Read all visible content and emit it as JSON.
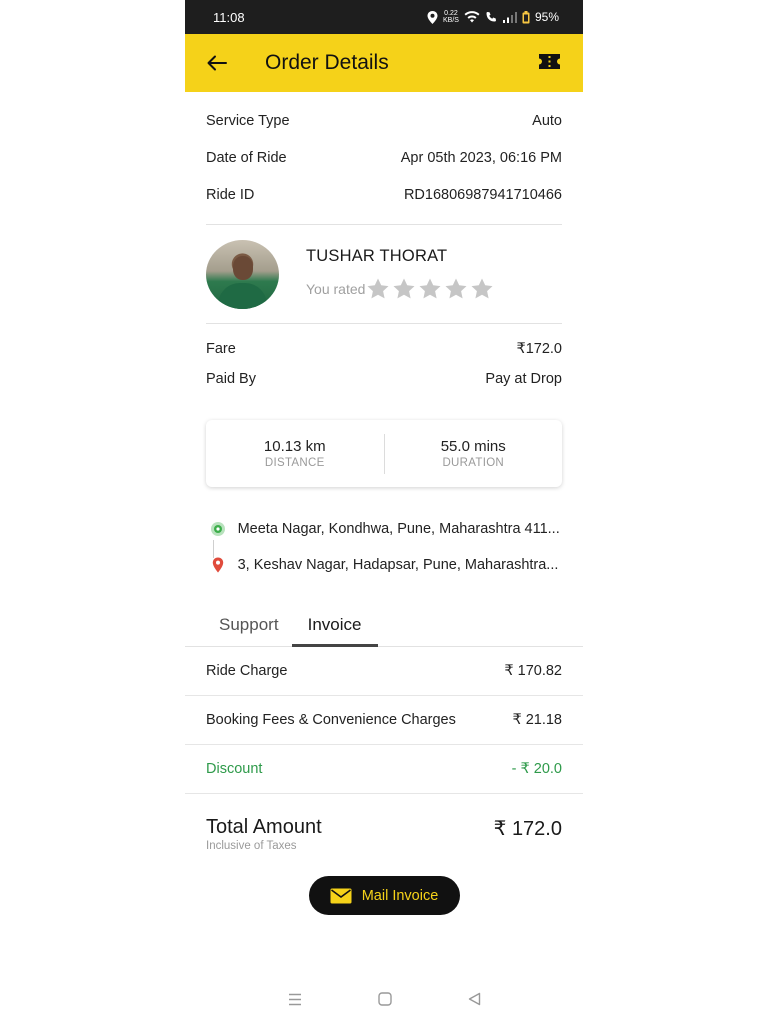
{
  "status_bar": {
    "time": "11:08",
    "data_speed": "0.22",
    "data_unit": "KB/S",
    "battery": "95%"
  },
  "app_bar": {
    "title": "Order Details",
    "back_icon": "arrow-left-icon",
    "action_icon": "ticket-icon"
  },
  "ride_info": [
    {
      "label": "Service Type",
      "value": "Auto"
    },
    {
      "label": "Date of Ride",
      "value": "Apr 05th 2023, 06:16 PM"
    },
    {
      "label": "Ride ID",
      "value": "RD16806987941710466"
    }
  ],
  "driver": {
    "name": "TUSHAR  THORAT",
    "rating_label": "You rated",
    "rating_value": 0,
    "rating_max": 5
  },
  "payment": [
    {
      "label": "Fare",
      "value": "₹172.0"
    },
    {
      "label": "Paid By",
      "value": "Pay at Drop"
    }
  ],
  "stats": {
    "distance_value": "10.13 km",
    "distance_label": "DISTANCE",
    "duration_value": "55.0 mins",
    "duration_label": "DURATION"
  },
  "route": {
    "pickup": "Meeta Nagar, Kondhwa, Pune, Maharashtra 411...",
    "drop": "3, Keshav Nagar, Hadapsar, Pune, Maharashtra..."
  },
  "tabs": [
    {
      "label": "Support",
      "active": false
    },
    {
      "label": "Invoice",
      "active": true
    }
  ],
  "invoice": [
    {
      "label": "Ride Charge",
      "value": "₹  170.82"
    },
    {
      "label": "Booking Fees & Convenience Charges",
      "value": "₹  21.18"
    },
    {
      "label": "Discount",
      "value": "- ₹  20.0"
    }
  ],
  "total": {
    "label": "Total Amount",
    "sub": "Inclusive of Taxes",
    "value": "₹  172.0"
  },
  "mail_button": {
    "label": "Mail Invoice"
  },
  "colors": {
    "accent": "#f5d219",
    "discount": "#2e9a4a",
    "pickup_pin": "#3cae4a",
    "drop_pin": "#e04b3c"
  }
}
